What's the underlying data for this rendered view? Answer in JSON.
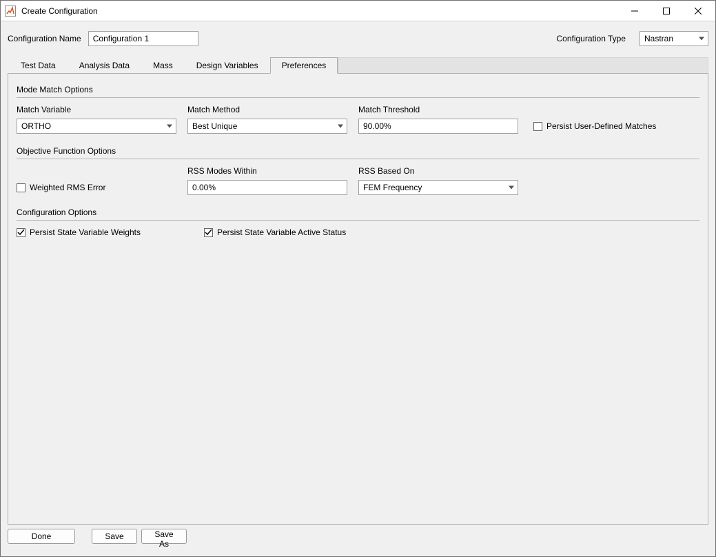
{
  "window": {
    "title": "Create Configuration"
  },
  "header": {
    "config_name_label": "Configuration Name",
    "config_name_value": "Configuration 1",
    "config_type_label": "Configuration Type",
    "config_type_value": "Nastran"
  },
  "tabs": {
    "test_data": "Test Data",
    "analysis_data": "Analysis Data",
    "mass": "Mass",
    "design_variables": "Design Variables",
    "preferences": "Preferences",
    "active": "preferences"
  },
  "prefs": {
    "mode_match_title": "Mode Match Options",
    "match_variable_label": "Match Variable",
    "match_variable_value": "ORTHO",
    "match_method_label": "Match Method",
    "match_method_value": "Best Unique",
    "match_threshold_label": "Match Threshold",
    "match_threshold_value": "90.00%",
    "persist_matches_label": "Persist User-Defined Matches",
    "persist_matches_checked": false,
    "obj_fn_title": "Objective Function Options",
    "weighted_rms_label": "Weighted RMS Error",
    "weighted_rms_checked": false,
    "rss_modes_label": "RSS Modes Within",
    "rss_modes_value": "0.00%",
    "rss_based_label": "RSS Based On",
    "rss_based_value": "FEM Frequency",
    "config_options_title": "Configuration Options",
    "persist_weights_label": "Persist State Variable Weights",
    "persist_weights_checked": true,
    "persist_active_label": "Persist State Variable Active Status",
    "persist_active_checked": true
  },
  "footer": {
    "done": "Done",
    "save": "Save",
    "save_as": "Save As"
  }
}
